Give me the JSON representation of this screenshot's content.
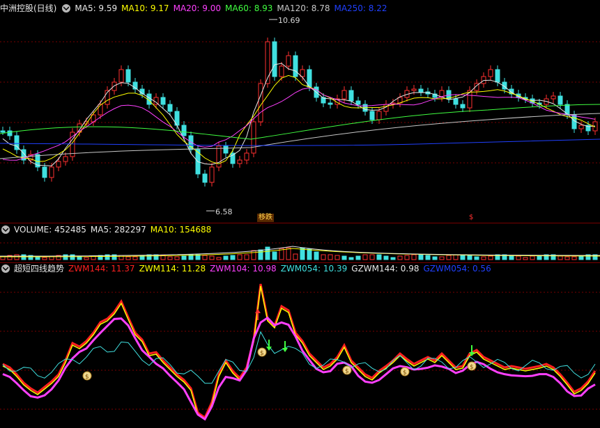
{
  "header_price": {
    "title": "中洲控股(日线)",
    "items": [
      {
        "label": "MA5: 9.59",
        "color": "#e8e8e8"
      },
      {
        "label": "MA10: 9.17",
        "color": "#ffff00"
      },
      {
        "label": "MA20: 9.00",
        "color": "#ff40ff"
      },
      {
        "label": "MA60: 8.93",
        "color": "#40ff40"
      },
      {
        "label": "MA120: 8.78",
        "color": "#c8c8c8"
      },
      {
        "label": "MA250: 8.22",
        "color": "#2040ff"
      }
    ]
  },
  "header_volume": {
    "items": [
      {
        "label": "VOLUME: 452485",
        "color": "#e8e8e8"
      },
      {
        "label": "MA5: 282297",
        "color": "#e8e8e8"
      },
      {
        "label": "MA10: 154688",
        "color": "#ffff00"
      }
    ]
  },
  "header_indicator": {
    "title": "超短四线趋势",
    "items": [
      {
        "label": "ZWM144: 11.37",
        "color": "#ff2020"
      },
      {
        "label": "ZWM114: 11.28",
        "color": "#ffff00"
      },
      {
        "label": "ZWM104: 10.98",
        "color": "#ff40ff"
      },
      {
        "label": "ZWM054: 10.39",
        "color": "#40e0e0"
      },
      {
        "label": "GZWM144: 0.98",
        "color": "#e8e8e8"
      },
      {
        "label": "GZWM054: 0.56",
        "color": "#2040ff"
      }
    ]
  },
  "annotations": {
    "high": "10.69",
    "low": "6.58",
    "event_tag": "移跌",
    "s_marker": "$"
  },
  "icons": {
    "collapse": "chevron-down-icon",
    "signal": "money-bag-icon"
  },
  "colors": {
    "up": "#ff3030",
    "down": "#40e0e0",
    "grid": "#7a0000"
  }
}
